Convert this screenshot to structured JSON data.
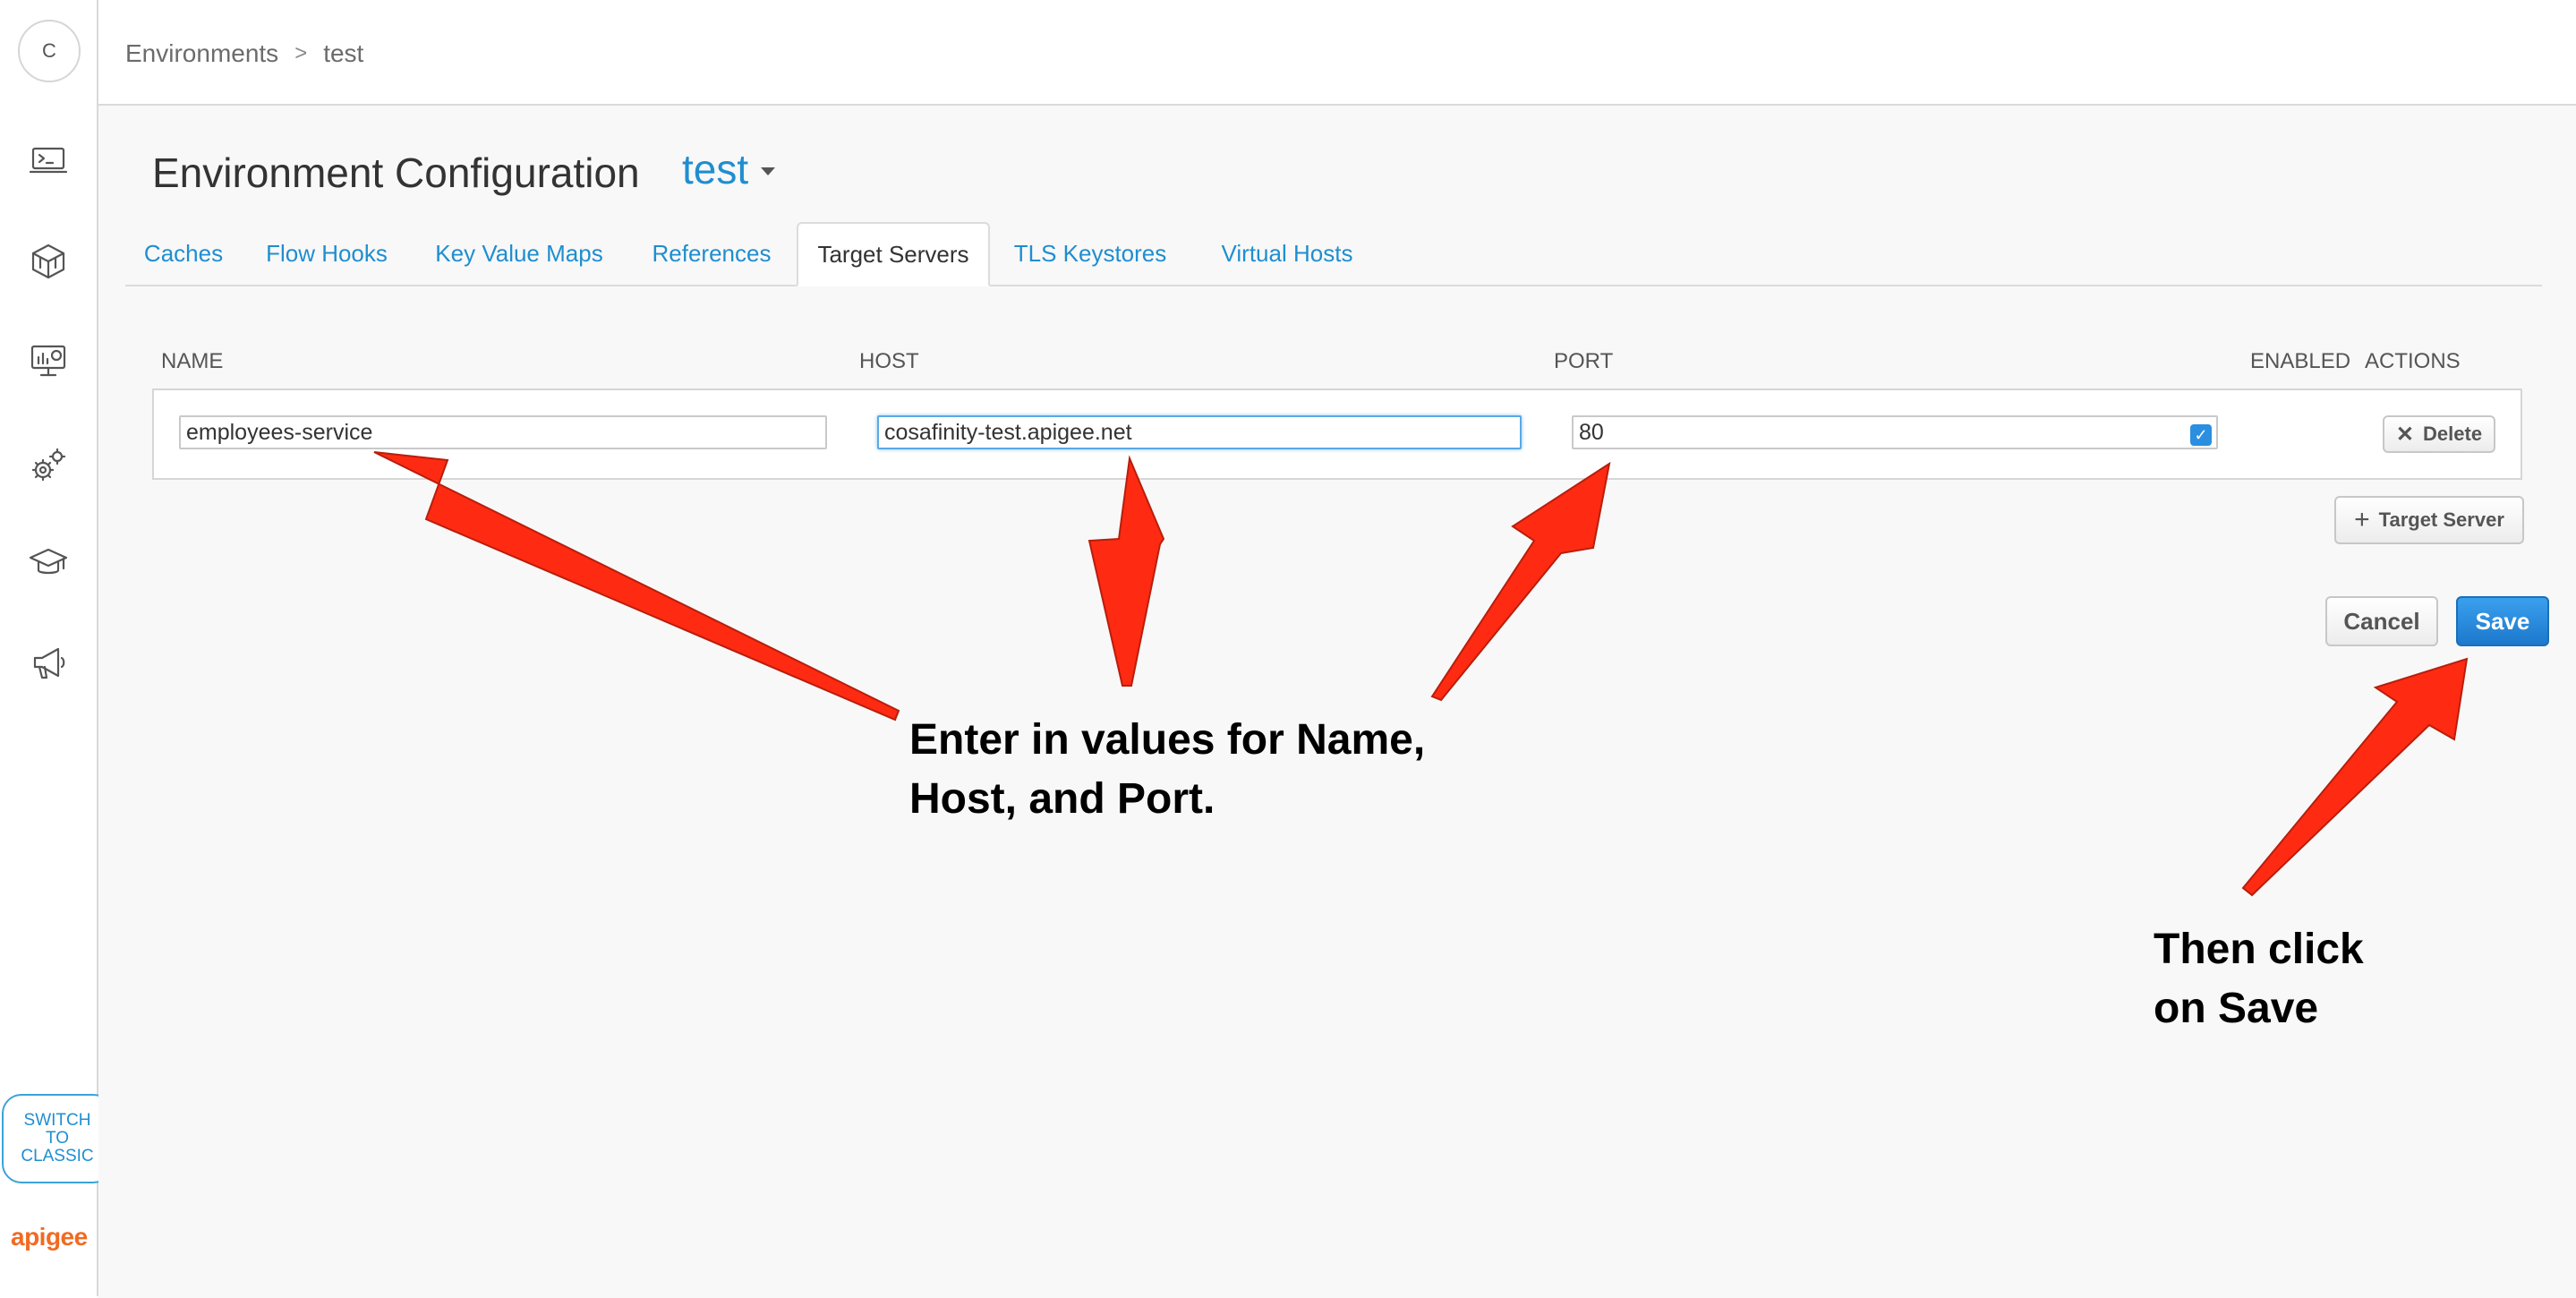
{
  "user": {
    "avatar_initial": "C"
  },
  "breadcrumb": {
    "root": "Environments",
    "separator": ">",
    "current": "test"
  },
  "rail": {
    "icons": [
      "terminal-icon",
      "packages-icon",
      "analytics-monitor-icon",
      "gears-icon",
      "graduation-cap-icon",
      "megaphone-icon"
    ],
    "switch_classic": {
      "line1": "SWITCH",
      "line2": "TO",
      "line3": "CLASSIC"
    },
    "logo_text": "apigee"
  },
  "page": {
    "title": "Environment Configuration",
    "environment": "test"
  },
  "tabs": [
    {
      "label": "Caches",
      "active": false
    },
    {
      "label": "Flow Hooks",
      "active": false
    },
    {
      "label": "Key Value Maps",
      "active": false
    },
    {
      "label": "References",
      "active": false
    },
    {
      "label": "Target Servers",
      "active": true
    },
    {
      "label": "TLS Keystores",
      "active": false
    },
    {
      "label": "Virtual Hosts",
      "active": false
    }
  ],
  "table": {
    "columns": {
      "name": "NAME",
      "host": "HOST",
      "port": "PORT",
      "enabled": "ENABLED",
      "actions": "ACTIONS"
    },
    "rows": [
      {
        "name": "employees-service",
        "host": "cosafinity-test.apigee.net",
        "port": "80",
        "enabled": true,
        "delete_label": "Delete"
      }
    ]
  },
  "buttons": {
    "add_target_server": "Target Server",
    "cancel": "Cancel",
    "save": "Save"
  },
  "annotations": {
    "enter_values": {
      "line1": "Enter in values for Name,",
      "line2": "Host, and Port."
    },
    "then_click": {
      "line1": "Then click",
      "line2": "on Save"
    }
  },
  "colors": {
    "link_blue": "#1f8ed0",
    "save_blue": "#1d78cc",
    "arrow_red": "#ff2a12",
    "logo_orange": "#f26a21"
  }
}
